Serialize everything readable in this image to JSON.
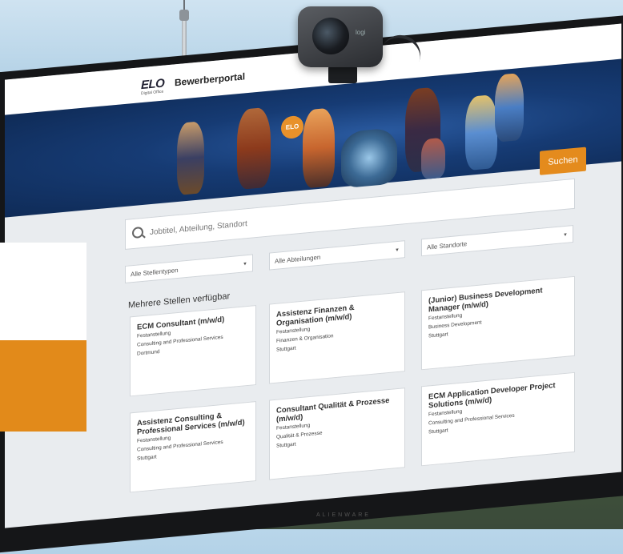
{
  "brand": {
    "logo": "ELO",
    "logo_sub": "Digital Office",
    "portal_title": "Bewerberportal"
  },
  "search": {
    "placeholder": "Jobtitel, Abteilung, Standort",
    "button_label": "Suchen"
  },
  "filters": [
    {
      "label": "Alle Stellentypen"
    },
    {
      "label": "Alle Abteilungen"
    },
    {
      "label": "Alle Standorte"
    }
  ],
  "results_heading": "Mehrere Stellen verfügbar",
  "jobs": [
    {
      "title": "ECM Consultant (m/w/d)",
      "type": "Festanstellung",
      "department": "Consulting and Professional Services",
      "location": "Dortmund"
    },
    {
      "title": "Assistenz Finanzen & Organisation (m/w/d)",
      "type": "Festanstellung",
      "department": "Finanzen & Organisation",
      "location": "Stuttgart"
    },
    {
      "title": "(Junior) Business Development Manager (m/w/d)",
      "type": "Festanstellung",
      "department": "Business Development",
      "location": "Stuttgart"
    },
    {
      "title": "Assistenz Consulting & Professional Services (m/w/d)",
      "type": "Festanstellung",
      "department": "Consulting and Professional Services",
      "location": "Stuttgart"
    },
    {
      "title": "Consultant Qualität & Prozesse (m/w/d)",
      "type": "Festanstellung",
      "department": "Qualität & Prozesse",
      "location": "Stuttgart"
    },
    {
      "title": "ECM Application Developer Project Solutions (m/w/d)",
      "type": "Festanstellung",
      "department": "Consulting and Professional Services",
      "location": "Stuttgart"
    }
  ],
  "monitor_brand": "ALIENWARE",
  "webcam_brand": "logi",
  "colors": {
    "accent": "#e48b1d",
    "banner": "#163b74"
  }
}
